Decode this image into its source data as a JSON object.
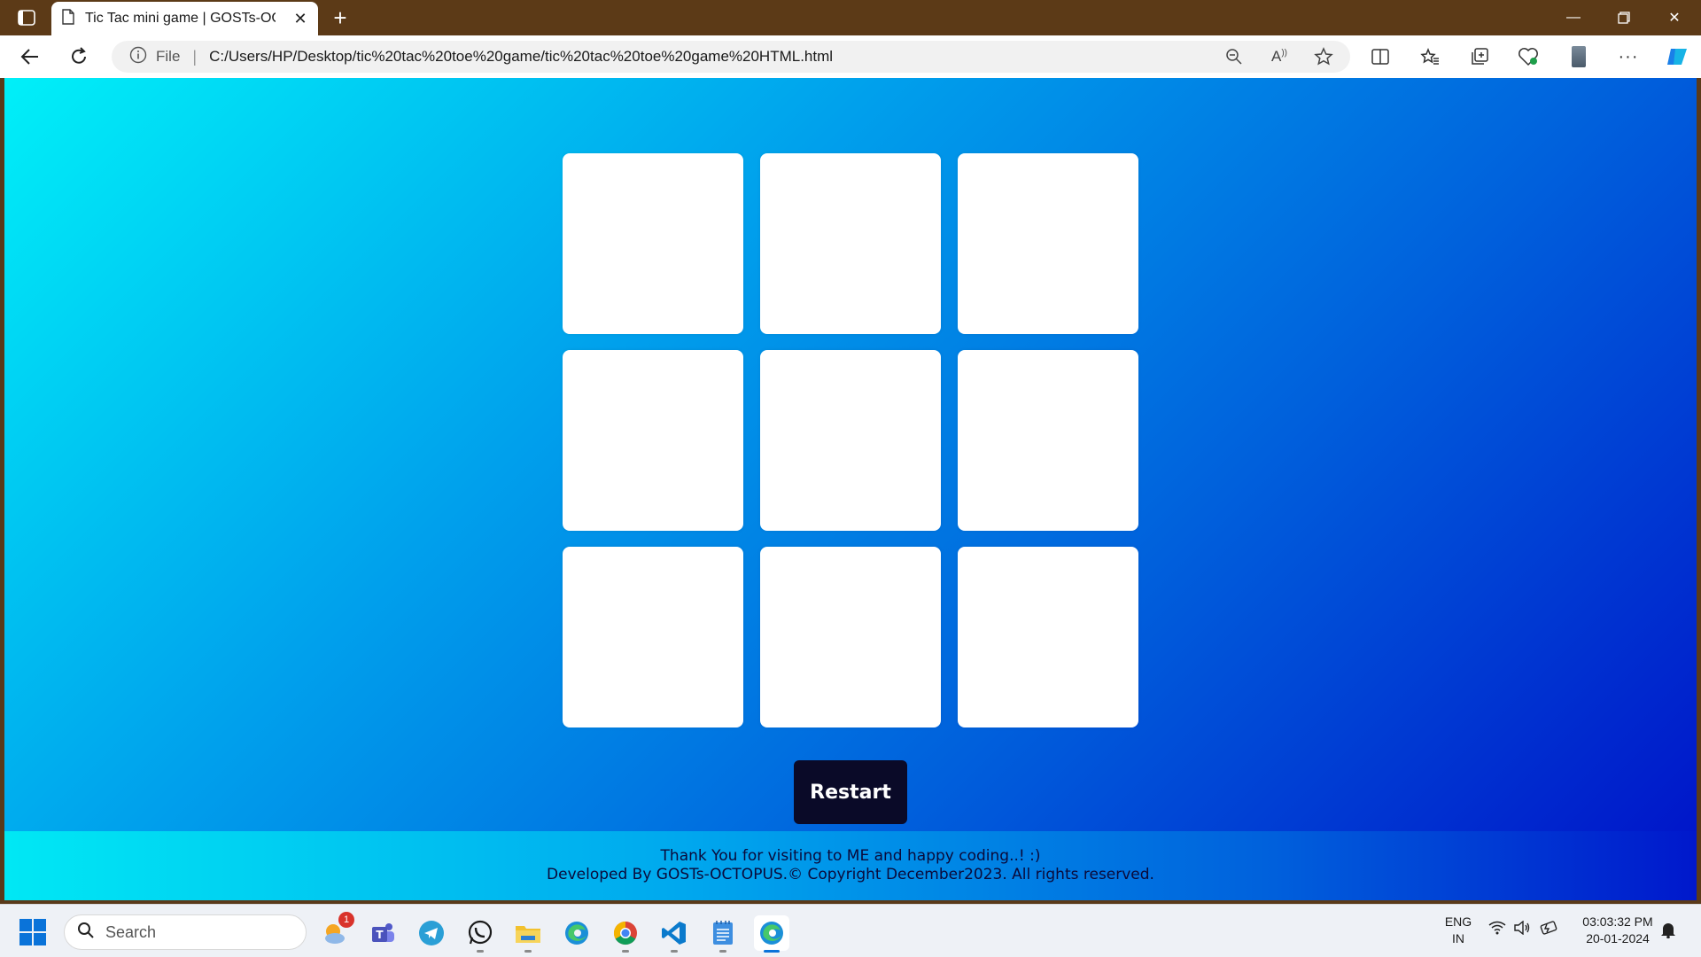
{
  "browser": {
    "tab_title": "Tic Tac mini game | GOSTs-OCTO",
    "address_prefix": "File",
    "address_url": "C:/Users/HP/Desktop/tic%20tac%20toe%20game/tic%20tac%20toe%20game%20HTML.html"
  },
  "game": {
    "cells": [
      "",
      "",
      "",
      "",
      "",
      "",
      "",
      "",
      ""
    ],
    "restart_label": "Restart"
  },
  "footer": {
    "line1": "Thank You for visiting to ME and happy coding..! :)",
    "line2": "Developed By GOSTs-OCTOPUS.© Copyright December2023. All rights reserved."
  },
  "taskbar": {
    "search_placeholder": "Search",
    "weather_badge": "1",
    "language": "ENG",
    "region": "IN",
    "time": "03:03:32 PM",
    "date": "20-01-2024"
  },
  "colors": {
    "gradient_start": "#00f0f8",
    "gradient_end": "#0010c8",
    "button_bg": "#0a0a28",
    "tab_bar": "#5c3a17"
  }
}
